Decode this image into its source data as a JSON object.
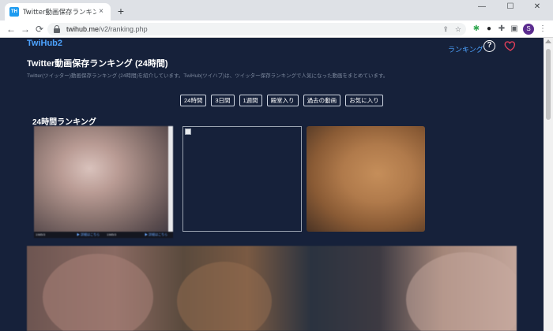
{
  "browser": {
    "tab_title": "Twitter動画保存ランキング - TwiHub",
    "favicon_text": "TH",
    "tab_close": "×",
    "new_tab": "+",
    "url_host": "twihub.me",
    "url_path": "/v2/ranking.php",
    "profile_initial": "S",
    "window_controls": {
      "minimize": "—",
      "maximize": "☐",
      "close": "✕"
    },
    "nav": {
      "back": "←",
      "forward": "→",
      "reload": "⟳"
    },
    "icons": [
      "share-icon",
      "star-icon",
      "extension-icon",
      "puzzle-icon",
      "sidepanel-icon",
      "menu-icon"
    ]
  },
  "site": {
    "logo": "TwiHub2",
    "ranking_link": "ランキング",
    "help_symbol": "?",
    "heart_color": "#e8405a"
  },
  "page": {
    "title": "Twitter動画保存ランキング (24時間)",
    "description": "Twitter(ツイッター)動画保存ランキング (24時間)を紹介しています。TwiHub(ツイハブ)は、ツイッター保存ランキングで人気になった動画をまとめています。",
    "filters": [
      "24時間",
      "3日間",
      "1週間",
      "殿堂入り",
      "過去の動画",
      "お気に入り"
    ],
    "section_title": "24時間ランキング"
  },
  "thumbnails": {
    "first_caption_left": "1985/3",
    "first_caption_link": "▶ 詳細はこちら",
    "first_caption_left2": "1985/3",
    "first_caption_link2": "▶ 詳細はこちら"
  },
  "colors": {
    "page_bg": "#16213a",
    "accent": "#4da3ff",
    "text": "#ffffff",
    "muted": "#7b879c"
  }
}
